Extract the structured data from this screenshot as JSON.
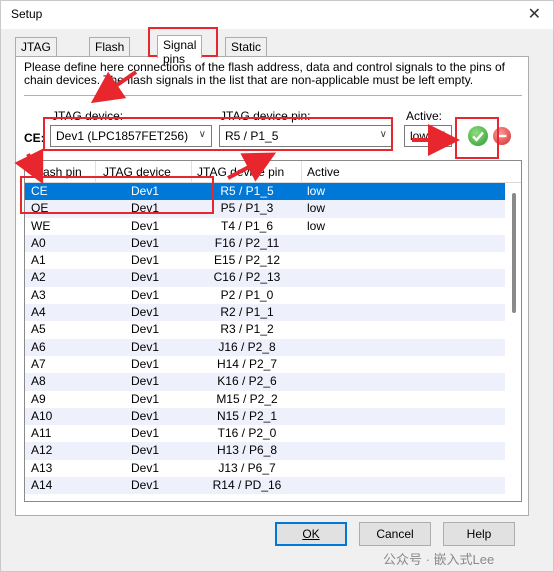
{
  "window": {
    "title": "Setup",
    "close": "✕"
  },
  "tabs": [
    {
      "label": "JTAG chain"
    },
    {
      "label": "Flash array"
    },
    {
      "label": "Signal pins"
    },
    {
      "label": "Static pins"
    }
  ],
  "description": "Please define here connections of the flash address, data and control signals to the pins of chain devices. The flash signals in the list that are non-applicable must be left empty.",
  "fields": {
    "jtag_device_label": "JTAG device:",
    "jtag_device_pin_label": "JTAG device pin:",
    "active_label": "Active:",
    "ce_label": "CE:",
    "device_value": "Dev1 (LPC1857FET256)",
    "pin_value": "R5 / P1_5",
    "active_value": "low"
  },
  "table": {
    "headers": [
      "Flash pin",
      "JTAG device",
      "JTAG device pin",
      "Active"
    ],
    "rows": [
      {
        "pin": "CE",
        "device": "Dev1",
        "dpin": "R5 / P1_5",
        "active": "low"
      },
      {
        "pin": "OE",
        "device": "Dev1",
        "dpin": "P5 / P1_3",
        "active": "low"
      },
      {
        "pin": "WE",
        "device": "Dev1",
        "dpin": "T4 / P1_6",
        "active": "low"
      },
      {
        "pin": "A0",
        "device": "Dev1",
        "dpin": "F16 / P2_11",
        "active": ""
      },
      {
        "pin": "A1",
        "device": "Dev1",
        "dpin": "E15 / P2_12",
        "active": ""
      },
      {
        "pin": "A2",
        "device": "Dev1",
        "dpin": "C16 / P2_13",
        "active": ""
      },
      {
        "pin": "A3",
        "device": "Dev1",
        "dpin": "P2 / P1_0",
        "active": ""
      },
      {
        "pin": "A4",
        "device": "Dev1",
        "dpin": "R2 / P1_1",
        "active": ""
      },
      {
        "pin": "A5",
        "device": "Dev1",
        "dpin": "R3 / P1_2",
        "active": ""
      },
      {
        "pin": "A6",
        "device": "Dev1",
        "dpin": "J16 / P2_8",
        "active": ""
      },
      {
        "pin": "A7",
        "device": "Dev1",
        "dpin": "H14 / P2_7",
        "active": ""
      },
      {
        "pin": "A8",
        "device": "Dev1",
        "dpin": "K16 / P2_6",
        "active": ""
      },
      {
        "pin": "A9",
        "device": "Dev1",
        "dpin": "M15 / P2_2",
        "active": ""
      },
      {
        "pin": "A10",
        "device": "Dev1",
        "dpin": "N15 / P2_1",
        "active": ""
      },
      {
        "pin": "A11",
        "device": "Dev1",
        "dpin": "T16 / P2_0",
        "active": ""
      },
      {
        "pin": "A12",
        "device": "Dev1",
        "dpin": "H13 / P6_8",
        "active": ""
      },
      {
        "pin": "A13",
        "device": "Dev1",
        "dpin": "J13 / P6_7",
        "active": ""
      },
      {
        "pin": "A14",
        "device": "Dev1",
        "dpin": "R14 / PD_16",
        "active": ""
      }
    ]
  },
  "buttons": {
    "ok": "OK",
    "cancel": "Cancel",
    "help": "Help"
  },
  "watermark": "公众号 · 嵌入式Lee",
  "colors": {
    "selection": "#0078d7",
    "annotation": "#e8262d",
    "apply_green": "#3aa63a",
    "remove_red": "#e23b3b"
  }
}
